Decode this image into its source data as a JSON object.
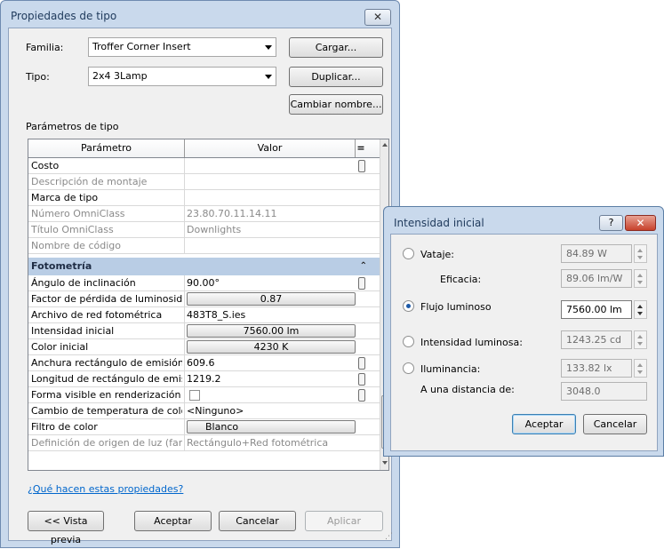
{
  "main_window": {
    "title": "Propiedades de tipo",
    "close_label": "✕",
    "familia_label": "Familia:",
    "familia_value": "Troffer Corner Insert",
    "tipo_label": "Tipo:",
    "tipo_value": "2x4 3Lamp",
    "cargar_label": "Cargar...",
    "duplicar_label": "Duplicar...",
    "cambiar_label": "Cambiar nombre...",
    "parametros_label": "Parámetros de tipo",
    "grid_header": {
      "param": "Parámetro",
      "value": "Valor",
      "sort": "="
    },
    "rows_top": [
      {
        "name": "Costo",
        "value": ""
      },
      {
        "name": "Descripción de montaje",
        "value": ""
      },
      {
        "name": "Marca de tipo",
        "value": ""
      },
      {
        "name": "Número OmniClass",
        "value": "23.80.70.11.14.11"
      },
      {
        "name": "Título OmniClass",
        "value": "Downlights"
      },
      {
        "name": "Nombre de código",
        "value": ""
      }
    ],
    "group_label": "Fotometría",
    "group_chevron": "⌃",
    "rows_photometry": [
      {
        "name": "Ángulo de inclinación",
        "value": "90.00°"
      },
      {
        "name": "Factor de pérdida de luminosidad",
        "value": "0.87"
      },
      {
        "name": "Archivo de red fotométrica",
        "value": "483T8_S.ies"
      },
      {
        "name": "Intensidad inicial",
        "value": "7560.00 lm"
      },
      {
        "name": "Color inicial",
        "value": "4230 K"
      },
      {
        "name": "Anchura rectángulo de emisión",
        "value": "609.6"
      },
      {
        "name": "Longitud de rectángulo de emisión",
        "value": "1219.2"
      },
      {
        "name": "Forma visible en renderización",
        "value": ""
      },
      {
        "name": "Cambio de temperatura de color",
        "value": "<Ninguno>"
      },
      {
        "name": "Filtro de color",
        "value": "Blanco"
      },
      {
        "name": "Definición de origen de luz (familia)",
        "value": "Rectángulo+Red fotométrica"
      }
    ],
    "help_link": "¿Qué hacen estas propiedades?",
    "preview_label": "<< Vista previa",
    "ok_label": "Aceptar",
    "cancel_label": "Cancelar",
    "apply_label": "Aplicar"
  },
  "dialog": {
    "title": "Intensidad inicial",
    "help_label": "?",
    "close_label": "✕",
    "vataje_label": "Vataje:",
    "vataje_value": "84.89 W",
    "eficacia_label": "Eficacia:",
    "eficacia_value": "89.06 lm/W",
    "flujo_label": "Flujo luminoso",
    "flujo_value": "7560.00 lm",
    "intensidad_label": "Intensidad luminosa:",
    "intensidad_value": "1243.25 cd",
    "iluminancia_label": "Iluminancia:",
    "iluminancia_value": "133.82 lx",
    "distancia_label": "A una distancia de:",
    "distancia_value": "3048.0",
    "ok_label": "Aceptar",
    "cancel_label": "Cancelar"
  }
}
